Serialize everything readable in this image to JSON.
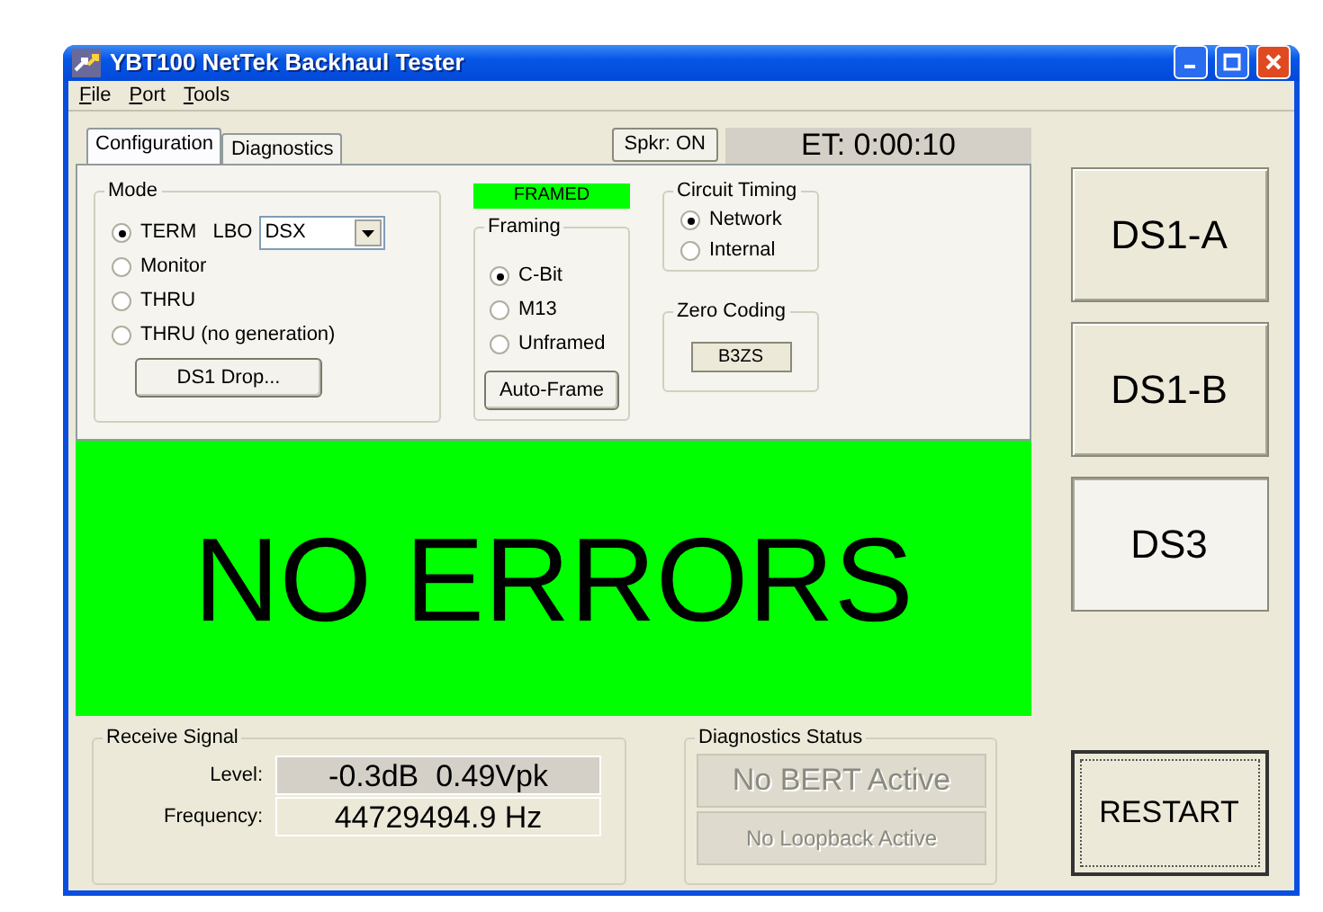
{
  "window": {
    "title": "YBT100 NetTek Backhaul Tester"
  },
  "menu": [
    {
      "label": "File"
    },
    {
      "label": "Port"
    },
    {
      "label": "Tools"
    }
  ],
  "tabs": [
    {
      "label": "Configuration",
      "selected": true
    },
    {
      "label": "Diagnostics",
      "selected": false
    }
  ],
  "speaker_button": "Spkr: ON",
  "elapsed_time": "ET: 0:00:10",
  "mode": {
    "title": "Mode",
    "options": [
      {
        "label": "TERM",
        "selected": true
      },
      {
        "label": "Monitor",
        "selected": false
      },
      {
        "label": "THRU",
        "selected": false
      },
      {
        "label": "THRU (no generation)",
        "selected": false
      }
    ],
    "lbo": {
      "label": "LBO",
      "value": "DSX"
    },
    "button": "DS1 Drop..."
  },
  "framing": {
    "status": "FRAMED",
    "title": "Framing",
    "options": [
      {
        "label": "C-Bit",
        "selected": true
      },
      {
        "label": "M13",
        "selected": false
      },
      {
        "label": "Unframed",
        "selected": false
      }
    ],
    "button": "Auto-Frame"
  },
  "circuit_timing": {
    "title": "Circuit Timing",
    "options": [
      {
        "label": "Network",
        "selected": true
      },
      {
        "label": "Internal",
        "selected": false
      }
    ]
  },
  "zero_coding": {
    "title": "Zero Coding",
    "value": "B3ZS"
  },
  "banner": {
    "text": "NO ERRORS",
    "color": "#00ff00"
  },
  "receive_signal": {
    "title": "Receive Signal",
    "rows": [
      {
        "label": "Level:",
        "value": "-0.3dB  0.49Vpk"
      },
      {
        "label": "Frequency:",
        "value": "44729494.9 Hz"
      }
    ]
  },
  "diagnostics_status": {
    "title": "Diagnostics Status",
    "items": [
      {
        "text": "No BERT Active",
        "disabled": true
      },
      {
        "text": "No Loopback Active",
        "disabled": true
      }
    ]
  },
  "channel_buttons": [
    {
      "label": "DS1-A",
      "selected": false
    },
    {
      "label": "DS1-B",
      "selected": false
    },
    {
      "label": "DS3",
      "selected": true
    }
  ],
  "restart_button": "RESTART"
}
